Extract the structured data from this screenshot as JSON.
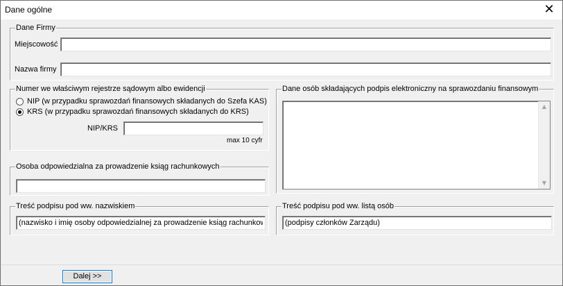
{
  "window": {
    "title": "Dane ogólne",
    "close_symbol": "✕"
  },
  "company": {
    "legend": "Dane Firmy",
    "city_label": "Miejscowość",
    "city_value": "",
    "name_label": "Nazwa firmy",
    "name_value": ""
  },
  "registry": {
    "legend": "Numer we właściwym rejestrze sądowym albo ewidencji",
    "options": [
      {
        "label": "NIP (w przypadku sprawozdań finansowych składanych do Szefa KAS)",
        "checked": false
      },
      {
        "label": "KRS (w przypadku sprawozdań finansowych składanych do KRS)",
        "checked": true
      }
    ],
    "number_label": "NIP/KRS",
    "number_value": "",
    "hint": "max 10 cyfr"
  },
  "signers": {
    "legend": "Dane osób składających podpis elektroniczny na sprawozdaniu finansowym",
    "text": ""
  },
  "bookkeeper": {
    "legend": "Osoba odpowiedzialna za prowadzenie ksiąg rachunkowych",
    "value": ""
  },
  "signature_name": {
    "legend": "Treść podpisu pod ww. nazwiskiem",
    "value": "(nazwisko i imię osoby odpowiedzialnej za prowadzenie ksiąg rachunkowych)"
  },
  "signature_list": {
    "legend": "Treść podpisu pod ww. listą osób",
    "value": "(podpisy członków Zarządu)"
  },
  "footer": {
    "next_button": "Dalej >>"
  }
}
